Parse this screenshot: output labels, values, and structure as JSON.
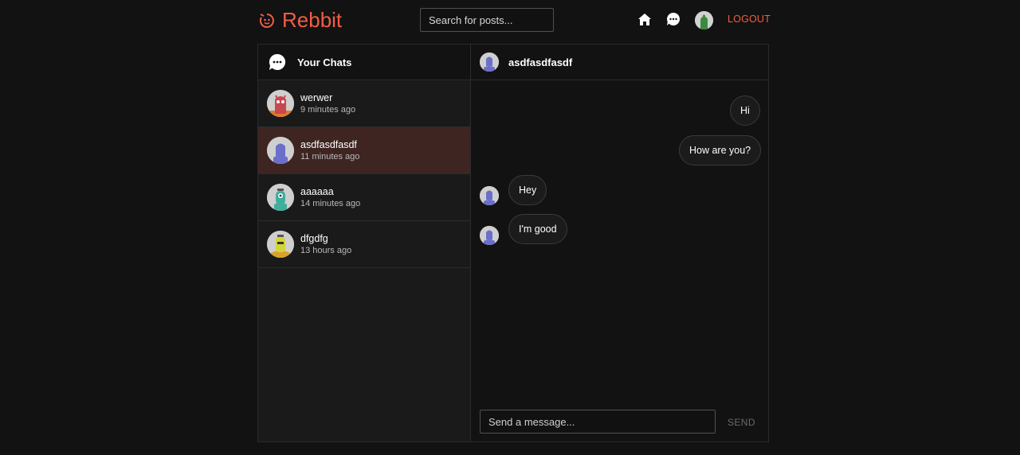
{
  "header": {
    "logo_text": "Rebbit",
    "search_placeholder": "Search for posts...",
    "logout_label": "LOGOUT",
    "brand_color": "#f25d45"
  },
  "sidebar": {
    "title": "Your Chats",
    "chats": [
      {
        "name": "werwer",
        "time": "9 minutes ago",
        "active": false
      },
      {
        "name": "asdfasdfasdf",
        "time": "11 minutes ago",
        "active": true
      },
      {
        "name": "aaaaaa",
        "time": "14 minutes ago",
        "active": false
      },
      {
        "name": "dfgdfg",
        "time": "13 hours ago",
        "active": false
      }
    ]
  },
  "conversation": {
    "contact_name": "asdfasdfasdf",
    "messages": [
      {
        "text": "Hi",
        "from": "me"
      },
      {
        "text": "How are you?",
        "from": "me"
      },
      {
        "text": "Hey",
        "from": "them"
      },
      {
        "text": "I'm good",
        "from": "them"
      }
    ],
    "input_placeholder": "Send a message...",
    "send_label": "SEND"
  }
}
